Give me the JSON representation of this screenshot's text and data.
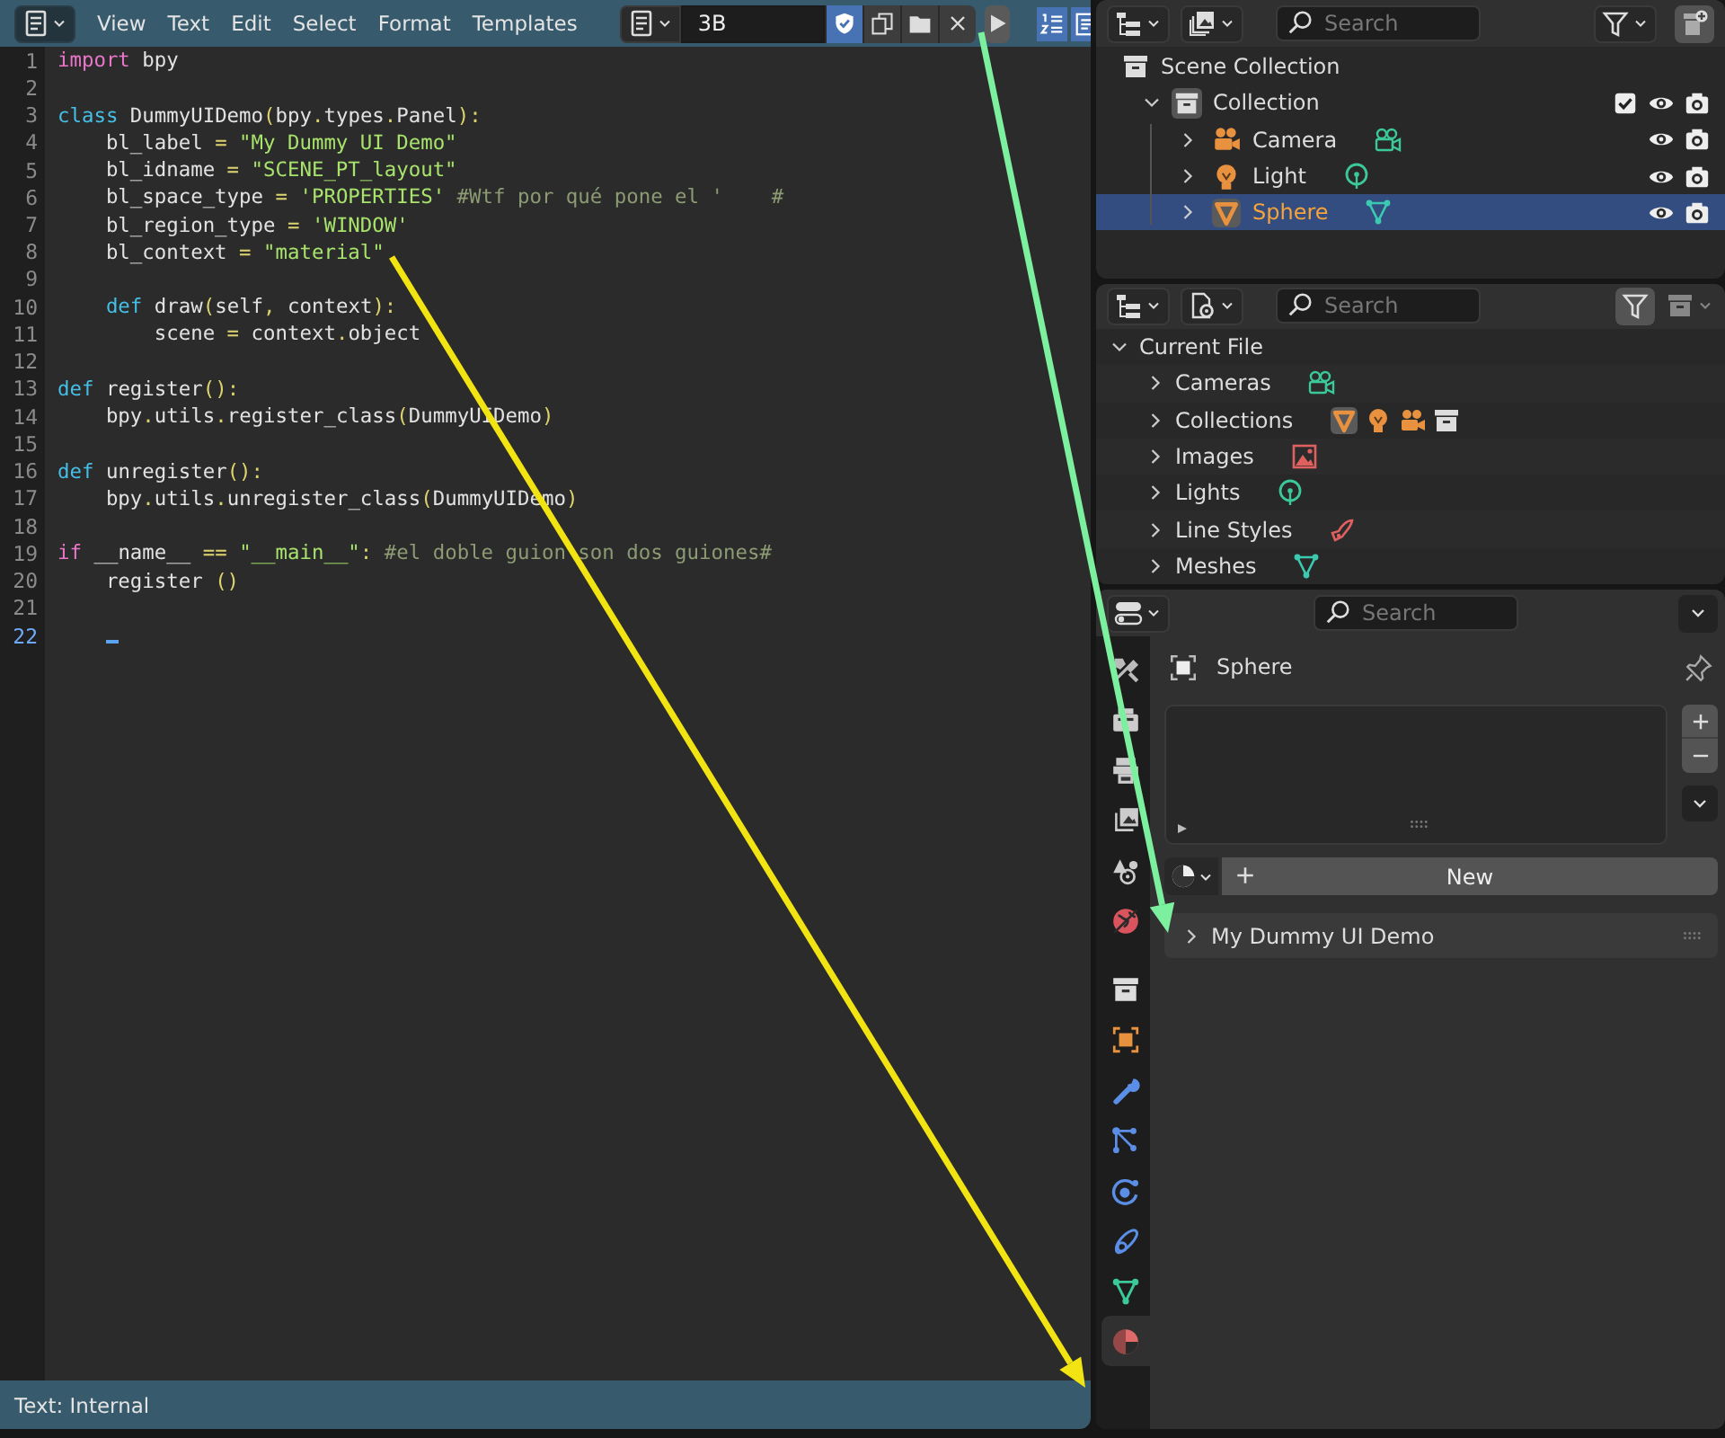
{
  "text_editor": {
    "menus": [
      "View",
      "Text",
      "Edit",
      "Select",
      "Format",
      "Templates"
    ],
    "text_name": "3B",
    "fake_user": true,
    "toggles": [
      {
        "kind": "line_numbers",
        "on": true
      },
      {
        "kind": "word_wrap",
        "on": true
      }
    ],
    "lines": [
      {
        "number": "1",
        "current": false,
        "tokens": [
          {
            "kind": "kw_flow",
            "t": "import"
          },
          {
            "kind": "plain",
            "t": " bpy"
          }
        ]
      },
      {
        "number": "2",
        "current": false
      },
      {
        "number": "3",
        "current": false,
        "tokens": [
          {
            "kind": "kw_def",
            "t": "class"
          },
          {
            "kind": "plain",
            "t": " DummyUIDemo"
          },
          {
            "kind": "op",
            "t": "("
          },
          {
            "kind": "plain",
            "t": "bpy"
          },
          {
            "kind": "op",
            "t": "."
          },
          {
            "kind": "plain",
            "t": "types"
          },
          {
            "kind": "op",
            "t": "."
          },
          {
            "kind": "plain",
            "t": "Panel"
          },
          {
            "kind": "op",
            "t": "):"
          }
        ]
      },
      {
        "number": "4",
        "current": false,
        "tokens": [
          {
            "kind": "plain",
            "t": "    bl_label "
          },
          {
            "kind": "op",
            "t": "= "
          },
          {
            "kind": "string",
            "t": "\"My Dummy UI Demo\""
          }
        ]
      },
      {
        "number": "5",
        "current": false,
        "tokens": [
          {
            "kind": "plain",
            "t": "    bl_idname "
          },
          {
            "kind": "op",
            "t": "= "
          },
          {
            "kind": "string",
            "t": "\"SCENE_PT_layout\""
          }
        ]
      },
      {
        "number": "6",
        "current": false,
        "tokens": [
          {
            "kind": "plain",
            "t": "    bl_space_type "
          },
          {
            "kind": "op",
            "t": "= "
          },
          {
            "kind": "string",
            "t": "'PROPERTIES'"
          },
          {
            "kind": "comment",
            "t": " #Wtf por qué pone el '    #"
          }
        ]
      },
      {
        "number": "7",
        "current": false,
        "tokens": [
          {
            "kind": "plain",
            "t": "    bl_region_type "
          },
          {
            "kind": "op",
            "t": "= "
          },
          {
            "kind": "string",
            "t": "'WINDOW'"
          }
        ]
      },
      {
        "number": "8",
        "current": false,
        "tokens": [
          {
            "kind": "plain",
            "t": "    bl_context "
          },
          {
            "kind": "op",
            "t": "= "
          },
          {
            "kind": "string",
            "t": "\"material\""
          }
        ]
      },
      {
        "number": "9",
        "current": false
      },
      {
        "number": "10",
        "current": false,
        "tokens": [
          {
            "kind": "kw_def",
            "t": "    def"
          },
          {
            "kind": "plain",
            "t": " draw"
          },
          {
            "kind": "op",
            "t": "("
          },
          {
            "kind": "plain",
            "t": "self"
          },
          {
            "kind": "op",
            "t": ", "
          },
          {
            "kind": "plain",
            "t": "context"
          },
          {
            "kind": "op",
            "t": "):"
          }
        ]
      },
      {
        "number": "11",
        "current": false,
        "tokens": [
          {
            "kind": "plain",
            "t": "        scene "
          },
          {
            "kind": "op",
            "t": "= "
          },
          {
            "kind": "plain",
            "t": "context"
          },
          {
            "kind": "op",
            "t": "."
          },
          {
            "kind": "plain",
            "t": "object"
          }
        ]
      },
      {
        "number": "12",
        "current": false
      },
      {
        "number": "13",
        "current": false,
        "tokens": [
          {
            "kind": "kw_def",
            "t": "def"
          },
          {
            "kind": "plain",
            "t": " register"
          },
          {
            "kind": "op",
            "t": "():"
          }
        ]
      },
      {
        "number": "14",
        "current": false,
        "tokens": [
          {
            "kind": "plain",
            "t": "    bpy"
          },
          {
            "kind": "op",
            "t": "."
          },
          {
            "kind": "plain",
            "t": "utils"
          },
          {
            "kind": "op",
            "t": "."
          },
          {
            "kind": "plain",
            "t": "register_class"
          },
          {
            "kind": "op",
            "t": "("
          },
          {
            "kind": "plain",
            "t": "DummyUIDemo"
          },
          {
            "kind": "op",
            "t": ")"
          }
        ]
      },
      {
        "number": "15",
        "current": false
      },
      {
        "number": "16",
        "current": false,
        "tokens": [
          {
            "kind": "kw_def",
            "t": "def"
          },
          {
            "kind": "plain",
            "t": " unregister"
          },
          {
            "kind": "op",
            "t": "():"
          }
        ]
      },
      {
        "number": "17",
        "current": false,
        "tokens": [
          {
            "kind": "plain",
            "t": "    bpy"
          },
          {
            "kind": "op",
            "t": "."
          },
          {
            "kind": "plain",
            "t": "utils"
          },
          {
            "kind": "op",
            "t": "."
          },
          {
            "kind": "plain",
            "t": "unregister_class"
          },
          {
            "kind": "op",
            "t": "("
          },
          {
            "kind": "plain",
            "t": "DummyUIDemo"
          },
          {
            "kind": "op",
            "t": ")"
          }
        ]
      },
      {
        "number": "18",
        "current": false
      },
      {
        "number": "19",
        "current": false,
        "tokens": [
          {
            "kind": "kw_flow",
            "t": "if"
          },
          {
            "kind": "plain",
            "t": " __name__ "
          },
          {
            "kind": "op",
            "t": "== "
          },
          {
            "kind": "string",
            "t": "\"__main__\""
          },
          {
            "kind": "op",
            "t": ": "
          },
          {
            "kind": "comment",
            "t": "#el doble guion son dos guiones#"
          }
        ]
      },
      {
        "number": "20",
        "current": false,
        "tokens": [
          {
            "kind": "plain",
            "t": "    register "
          },
          {
            "kind": "op",
            "t": "()"
          }
        ]
      },
      {
        "number": "21",
        "current": false
      },
      {
        "number": "22",
        "current": true
      }
    ],
    "status": "Text: Internal"
  },
  "outliner": {
    "search_placeholder": "Search",
    "tree": {
      "label": "Scene Collection",
      "kind": "scene_collection",
      "children": [
        {
          "label": "Collection",
          "kind": "collection",
          "expanded": true,
          "checked": true,
          "children": [
            {
              "label": "Camera",
              "kind": "camera",
              "expanded": false,
              "selected": false
            },
            {
              "label": "Light",
              "kind": "light",
              "expanded": false,
              "selected": false
            },
            {
              "label": "Sphere",
              "kind": "mesh",
              "expanded": false,
              "selected": true
            }
          ]
        }
      ]
    }
  },
  "file_view": {
    "search_placeholder": "Search",
    "filter_on": true,
    "tree": {
      "label": "Current File",
      "expanded": true,
      "children": [
        {
          "label": "Cameras",
          "kind": "cameras",
          "expanded": false
        },
        {
          "label": "Collections",
          "kind": "collections",
          "expanded": false
        },
        {
          "label": "Images",
          "kind": "images",
          "expanded": false
        },
        {
          "label": "Lights",
          "kind": "lights",
          "expanded": false
        },
        {
          "label": "Line Styles",
          "kind": "line_styles",
          "expanded": false
        },
        {
          "label": "Meshes",
          "kind": "meshes",
          "expanded": false
        }
      ]
    }
  },
  "properties": {
    "search_placeholder": "Search",
    "tabs": [
      {
        "kind": "tool",
        "selected": false
      },
      {
        "kind": "render",
        "selected": false
      },
      {
        "kind": "output",
        "selected": false
      },
      {
        "kind": "view_layer",
        "selected": false
      },
      {
        "kind": "scene",
        "selected": false
      },
      {
        "kind": "world",
        "selected": false
      },
      {
        "kind": "collection",
        "selected": false
      },
      {
        "kind": "object",
        "selected": false
      },
      {
        "kind": "modifiers",
        "selected": false
      },
      {
        "kind": "particles",
        "selected": false
      },
      {
        "kind": "physics",
        "selected": false
      },
      {
        "kind": "constraints",
        "selected": false
      },
      {
        "kind": "data",
        "selected": false
      },
      {
        "kind": "material",
        "selected": true
      }
    ],
    "object_name": "Sphere",
    "new_button": "New",
    "panels": [
      {
        "label": "My Dummy UI Demo",
        "expanded": false
      }
    ]
  },
  "annotations": [
    {
      "kind": "arrow",
      "color": "#f2e313"
    },
    {
      "kind": "arrow",
      "color": "#7df0a0"
    }
  ]
}
